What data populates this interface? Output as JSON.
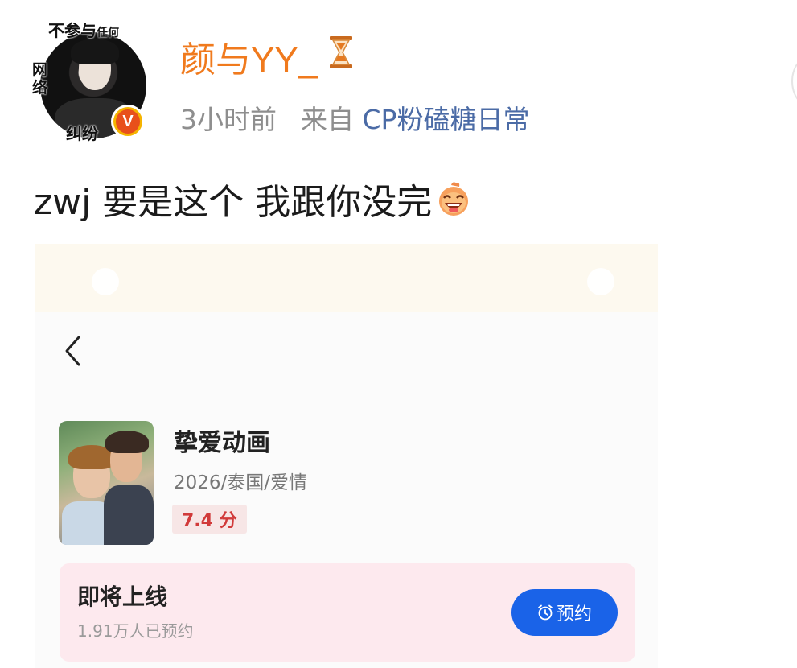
{
  "post": {
    "avatar_overlay": {
      "top": "不参与",
      "top_small": "任何",
      "left": "网络",
      "bottom": "纠纷"
    },
    "vip_badge": "V",
    "username": "颜与YY_",
    "username_icon": "hourglass-icon",
    "time": "3小时前",
    "from_label": "来自",
    "source": "CP粉磕糖日常",
    "text": "zwj 要是这个 我跟你没完",
    "text_emoji": "grinning-emoji-icon"
  },
  "screenshot": {
    "title": "挚爱动画",
    "info": "2026/泰国/爱情",
    "rating": "7.4 分",
    "coming_title": "即将上线",
    "coming_count": "1.91万人已预约",
    "reserve_label": "预约"
  },
  "colors": {
    "username": "#f07a1d",
    "source": "#4b6ba6",
    "rating": "#d13a3a",
    "reserve_button": "#1a63e8",
    "vip_badge": "#f5b400"
  }
}
